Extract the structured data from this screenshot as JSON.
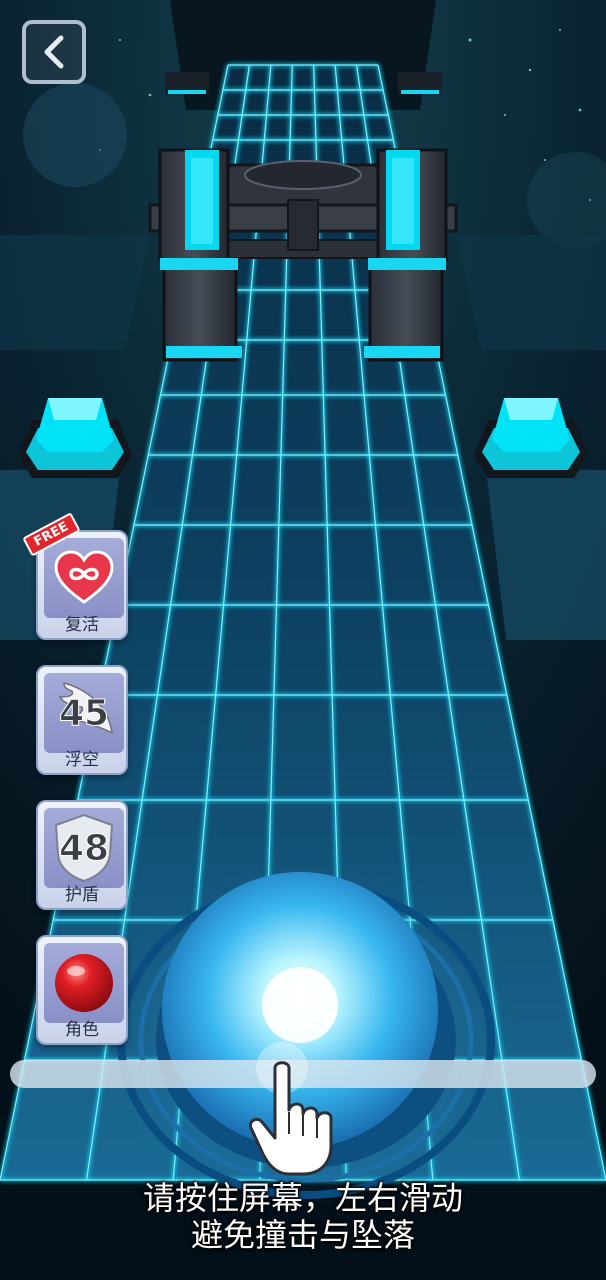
{
  "header": {
    "back_button_icon": "chevron-left-icon"
  },
  "powerups": [
    {
      "id": "revive",
      "label": "复活",
      "icon": "heart-infinity-icon",
      "badge": "FREE"
    },
    {
      "id": "float",
      "label": "浮空",
      "icon": "wing-icon",
      "count": "45"
    },
    {
      "id": "shield",
      "label": "护盾",
      "icon": "shield-icon",
      "count": "48"
    },
    {
      "id": "character",
      "label": "角色",
      "icon": "red-ball-icon"
    }
  ],
  "instructions": {
    "line1": "请按住屏幕，左右滑动",
    "line2": "避免撞击与坠落"
  },
  "colors": {
    "neon": "#19d6f2",
    "sky": "#04121e",
    "free_badge": "#e3262e",
    "heart": "#e8364a",
    "ball": "#e01f25"
  }
}
